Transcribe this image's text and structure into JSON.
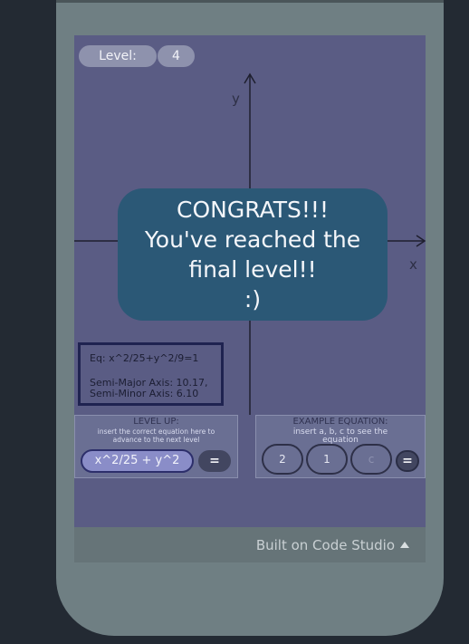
{
  "level": {
    "label": "Level:",
    "value": "4"
  },
  "axes": {
    "x_label": "x",
    "y_label": "y"
  },
  "congrats": {
    "line1": "CONGRATS!!!",
    "line2": "You've reached the",
    "line3": "final level!!",
    "line4": ":)"
  },
  "equation_info": {
    "equation": "Eq: x^2/25+y^2/9=1",
    "axes_text": "Semi-Major Axis: 10.17, Semi-Minor Axis: 6.10"
  },
  "level_up": {
    "title": "LEVEL UP:",
    "subtitle": "insert the correct equation here to advance to the next level",
    "input_value": "x^2/25 + y^2",
    "equals_label": "="
  },
  "example_equation": {
    "title": "EXAMPLE EQUATION:",
    "subtitle": "insert a, b, c to see the equation",
    "a_value": "2",
    "b_value": "1",
    "c_value": "c",
    "equals_label": "="
  },
  "footer": {
    "text": "Built on Code Studio"
  },
  "colors": {
    "screen_bg": "#5a5c84",
    "banner_bg": "#2b5876",
    "phone_frame": "#6f7f83",
    "page_bg": "#232a33"
  }
}
